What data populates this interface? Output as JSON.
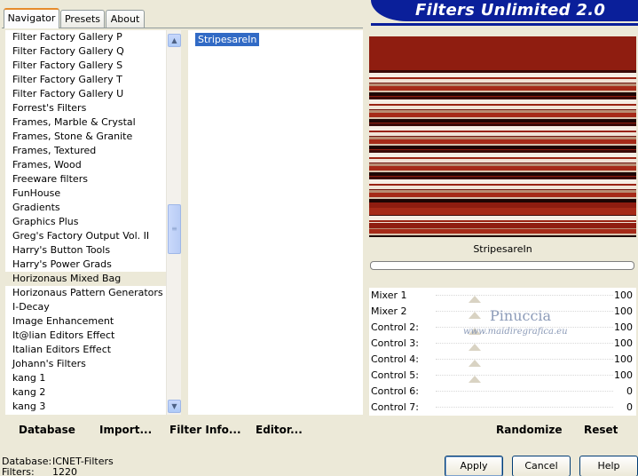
{
  "tabs": [
    "Navigator",
    "Presets",
    "About"
  ],
  "app_title": "Filters Unlimited 2.0",
  "categories": [
    "Filter Factory Gallery P",
    "Filter Factory Gallery Q",
    "Filter Factory Gallery S",
    "Filter Factory Gallery T",
    "Filter Factory Gallery U",
    "Forrest's Filters",
    "Frames, Marble & Crystal",
    "Frames, Stone & Granite",
    "Frames, Textured",
    "Frames, Wood",
    "Freeware filters",
    "FunHouse",
    "Gradients",
    "Graphics Plus",
    "Greg's Factory Output Vol. II",
    "Harry's Button Tools",
    "Harry's Power Grads",
    "Horizonaus Mixed Bag",
    "Horizonaus Pattern Generators",
    "I-Decay",
    "Image Enhancement",
    "It@lian Editors Effect",
    "Italian Editors Effect",
    "Johann's Filters",
    "kang 1",
    "kang 2",
    "kang 3"
  ],
  "selected_category": "Horizonaus Mixed Bag",
  "filters": [
    "StripesareIn"
  ],
  "selected_filter_name": "StripesareIn",
  "controls": [
    {
      "label": "Mixer 1",
      "value": "100",
      "level": 0.5
    },
    {
      "label": "Mixer 2",
      "value": "100",
      "level": 0.5
    },
    {
      "label": "Control 2:",
      "value": "100",
      "level": 0.5
    },
    {
      "label": "Control 3:",
      "value": "100",
      "level": 0.5
    },
    {
      "label": "Control 4:",
      "value": "100",
      "level": 0.5
    },
    {
      "label": "Control 5:",
      "value": "100",
      "level": 0.5
    },
    {
      "label": "Control 6:",
      "value": "0",
      "level": 0
    },
    {
      "label": "Control 7:",
      "value": "0",
      "level": 0
    }
  ],
  "watermark": {
    "name": "Pinuccia",
    "url": "www.maidiregrafica.eu"
  },
  "toolbar": {
    "database": "Database",
    "import": "Import...",
    "filter_info": "Filter Info...",
    "editor": "Editor...",
    "randomize": "Randomize",
    "reset": "Reset"
  },
  "status": {
    "database_label": "Database:",
    "database_value": "ICNET-Filters",
    "filters_label": "Filters:",
    "filters_value": "1220"
  },
  "buttons": {
    "apply": "Apply",
    "cancel": "Cancel",
    "help": "Help"
  },
  "stripe_colors": [
    "#8f1d10",
    "#a62a18",
    "#f1e3d6",
    "#3a0a08",
    "#d8c2ad",
    "#6e1610",
    "#f5ede4",
    "#1d0504",
    "#b98d73",
    "#9a2313"
  ]
}
